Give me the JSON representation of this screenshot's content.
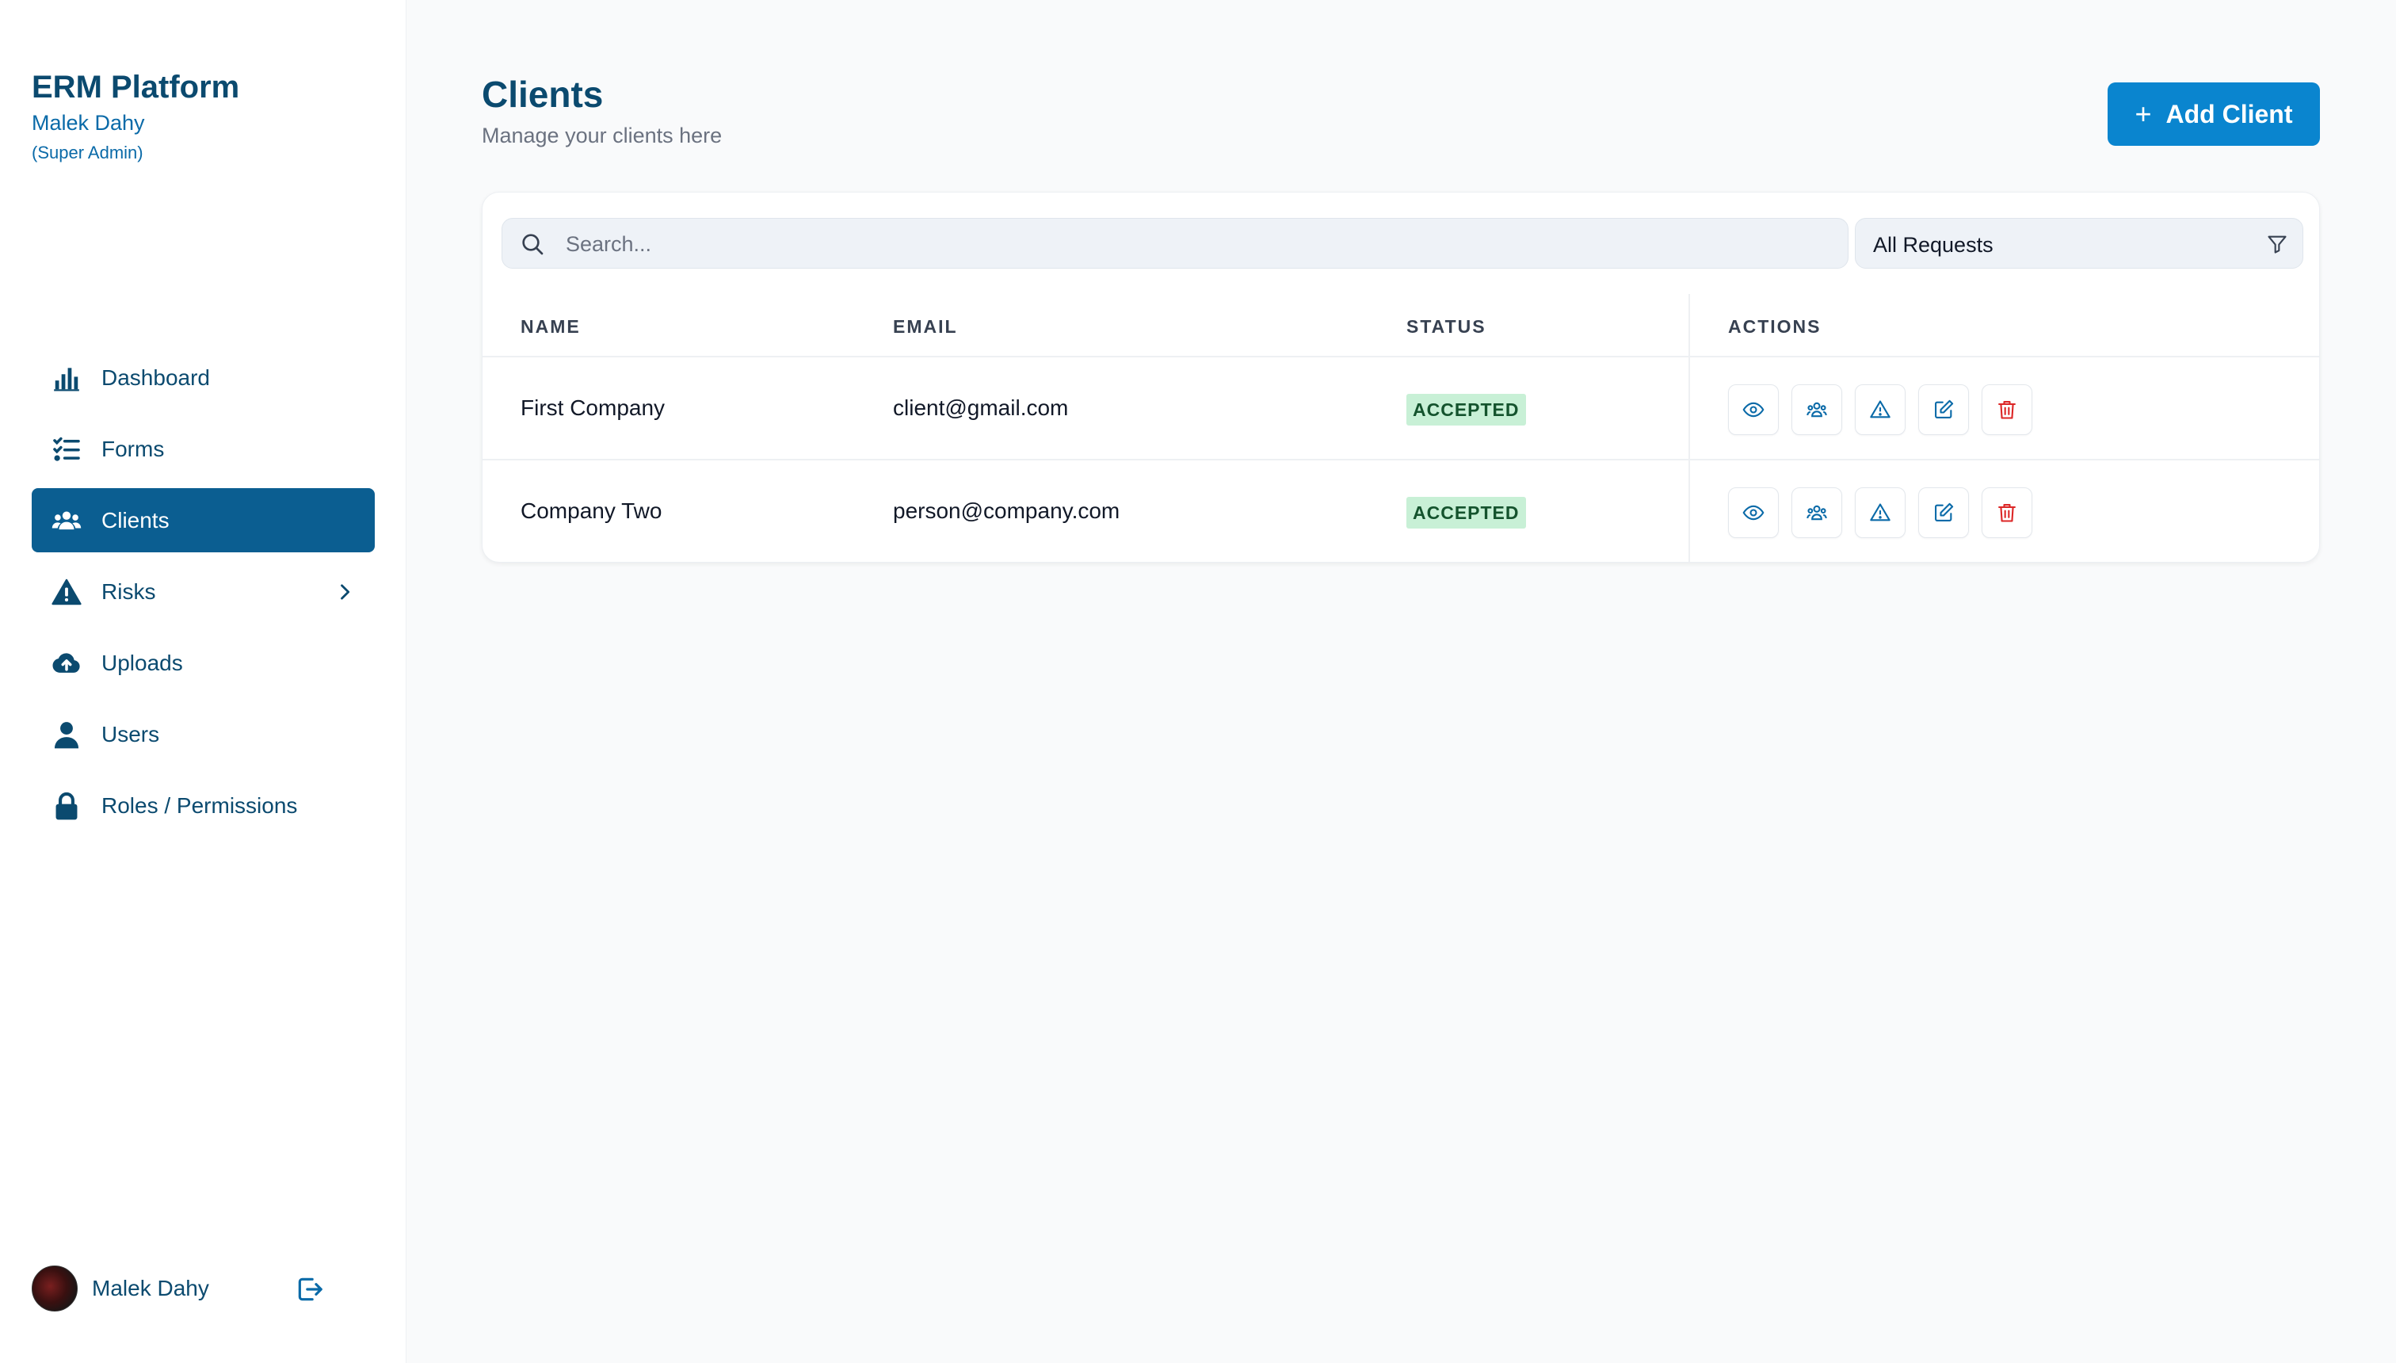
{
  "brand": {
    "title": "ERM Platform",
    "user": "Malek Dahy",
    "role": "(Super Admin)"
  },
  "nav": {
    "items": [
      {
        "label": "Dashboard",
        "icon": "bar-chart-icon"
      },
      {
        "label": "Forms",
        "icon": "checklist-icon"
      },
      {
        "label": "Clients",
        "icon": "users-icon",
        "active": true
      },
      {
        "label": "Risks",
        "icon": "warning-icon",
        "has_children": true
      },
      {
        "label": "Uploads",
        "icon": "cloud-upload-icon"
      },
      {
        "label": "Users",
        "icon": "user-icon"
      },
      {
        "label": "Roles / Permissions",
        "icon": "lock-icon"
      }
    ]
  },
  "footer": {
    "name": "Malek Dahy"
  },
  "page": {
    "title": "Clients",
    "subtitle": "Manage your clients here",
    "add_label": "Add Client"
  },
  "filters": {
    "search_placeholder": "Search...",
    "status_filter": "All Requests"
  },
  "table": {
    "headers": {
      "name": "NAME",
      "email": "EMAIL",
      "status": "STATUS",
      "actions": "ACTIONS"
    },
    "rows": [
      {
        "name": "First Company",
        "email": "client@gmail.com",
        "status": "ACCEPTED"
      },
      {
        "name": "Company Two",
        "email": "person@company.com",
        "status": "ACCEPTED"
      }
    ],
    "row_actions": [
      "eye-icon",
      "users-icon",
      "warning-icon",
      "edit-icon",
      "trash-icon"
    ]
  },
  "colors": {
    "primary": "#0b4a6f",
    "active_nav": "#0b5e91",
    "button": "#0a85cf",
    "badge_bg": "#c8f0d6",
    "badge_text": "#14532d",
    "danger": "#dc2626"
  }
}
